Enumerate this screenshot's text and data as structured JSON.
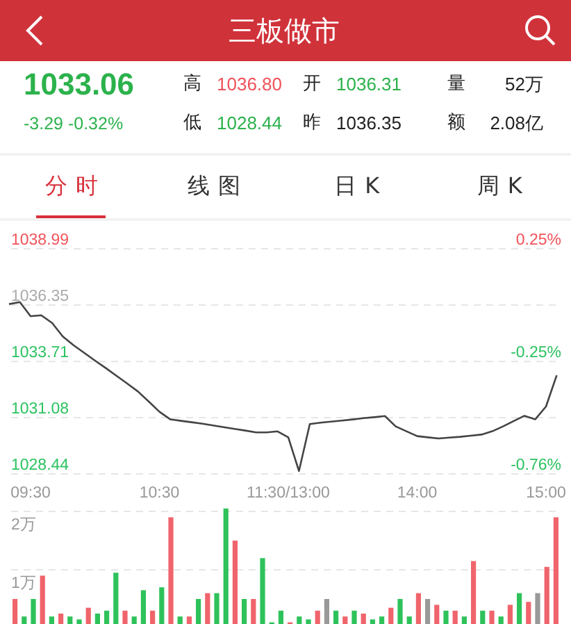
{
  "header": {
    "title": "三板做市"
  },
  "quote": {
    "price": "1033.06",
    "change": "-3.29 -0.32%",
    "color": "#2cb24c",
    "stats": [
      {
        "label": "高",
        "value": "1036.80",
        "color": "#f0525a"
      },
      {
        "label": "开",
        "value": "1036.31",
        "color": "#2cb24c"
      },
      {
        "label": "量",
        "value": "52万",
        "color": "#222222"
      },
      {
        "label": "低",
        "value": "1028.44",
        "color": "#2cb24c"
      },
      {
        "label": "昨",
        "value": "1036.35",
        "color": "#222222"
      },
      {
        "label": "额",
        "value": "2.08亿",
        "color": "#222222"
      }
    ]
  },
  "tabs": [
    {
      "label": "分时",
      "selected": true
    },
    {
      "label": "线图",
      "selected": false
    },
    {
      "label": "日K",
      "selected": false
    },
    {
      "label": "周K",
      "selected": false
    }
  ],
  "price_chart": {
    "left_axis": [
      {
        "color": "#f0525a"
      },
      {
        "color": "#aaaaaa"
      },
      {
        "color": "#2cc260"
      },
      {
        "color": "#2cc260"
      },
      {
        "color": "#2cc260"
      }
    ],
    "right_axis": [
      {
        "label": "0.25%",
        "color": "#f0525a"
      },
      {
        "label": "-0.25%",
        "color": "#2cc260"
      },
      {
        "label": "-0.76%",
        "color": "#2cc260"
      }
    ],
    "chart_data": {
      "type": "line",
      "grid": true,
      "ylim": [
        1028.44,
        1038.99
      ],
      "yticks": [
        {
          "value": 1038.99,
          "label": "1038.99"
        },
        {
          "value": 1036.35,
          "label": "1036.35"
        },
        {
          "value": 1033.71,
          "label": "1033.71"
        },
        {
          "value": 1031.08,
          "label": "1031.08"
        },
        {
          "value": 1028.44,
          "label": "1028.44"
        }
      ],
      "categories": [
        null,
        null,
        "09:30",
        null,
        null,
        null,
        null,
        null,
        null,
        null,
        null,
        null,
        null,
        null,
        "10:30",
        null,
        null,
        null,
        null,
        null,
        null,
        null,
        null,
        null,
        null,
        null,
        "11:30/13:00",
        null,
        null,
        null,
        null,
        null,
        null,
        null,
        null,
        null,
        null,
        null,
        "14:00",
        null,
        null,
        null,
        null,
        null,
        null,
        null,
        null,
        null,
        null,
        null,
        "15:00",
        null
      ],
      "series": [
        {
          "color": "#444444",
          "values": [
            1036.4,
            1036.49,
            1035.83,
            1035.87,
            1035.51,
            1034.88,
            1034.47,
            1034.11,
            1033.75,
            1033.4,
            1033.04,
            1032.67,
            1032.3,
            1031.83,
            1031.35,
            1031.0,
            1030.93,
            1030.86,
            1030.79,
            1030.71,
            1030.63,
            1030.55,
            1030.47,
            1030.39,
            1030.39,
            1030.43,
            1030.15,
            1028.58,
            1030.78,
            1030.84,
            1030.89,
            1030.94,
            1030.99,
            1031.05,
            1031.1,
            1031.15,
            1030.67,
            1030.44,
            1030.21,
            1030.15,
            1030.1,
            1030.14,
            1030.18,
            1030.23,
            1030.28,
            1030.44,
            1030.67,
            1030.92,
            1031.16,
            1031.0,
            1031.6,
            1033.06
          ]
        }
      ]
    }
  },
  "volume_chart": {
    "chart_data": {
      "type": "bar",
      "stacked": true,
      "ylim": [
        0,
        2.1
      ],
      "yticks": [
        {
          "value": 1,
          "label": "1万"
        },
        {
          "value": 2,
          "label": "2万"
        }
      ],
      "series": [
        {
          "color": "#f0646c",
          "values": [
            0.5,
            null,
            null,
            0.9,
            null,
            0.25,
            null,
            null,
            0.35,
            null,
            null,
            null,
            0.3,
            null,
            null,
            0.3,
            null,
            1.9,
            null,
            0.2,
            null,
            0.6,
            null,
            null,
            1.5,
            null,
            0.5,
            null,
            null,
            null,
            0.1,
            null,
            null,
            0.3,
            null,
            null,
            0.2,
            null,
            0.25,
            null,
            null,
            0.35,
            null,
            null,
            0.6,
            null,
            0.4,
            null,
            0.3,
            null,
            1.15,
            null,
            0.3,
            null,
            0.4,
            null,
            0.45,
            null,
            1.05,
            1.9
          ]
        },
        {
          "color": "#2ec25a",
          "values": [
            null,
            0.2,
            0.5,
            null,
            0.2,
            null,
            0.2,
            0.15,
            null,
            0.25,
            0.3,
            0.95,
            null,
            0.2,
            0.65,
            null,
            0.7,
            null,
            0.2,
            null,
            0.5,
            null,
            0.6,
            2.05,
            null,
            0.5,
            null,
            1.2,
            0.1,
            0.3,
            null,
            0.2,
            0.15,
            null,
            null,
            0.3,
            null,
            0.3,
            null,
            0.15,
            0.2,
            null,
            0.5,
            0.2,
            null,
            null,
            null,
            0.3,
            null,
            0.2,
            null,
            0.3,
            null,
            0.2,
            null,
            0.6,
            null,
            null,
            null,
            null
          ]
        },
        {
          "color": "#999999",
          "values": [
            null,
            null,
            null,
            null,
            null,
            null,
            null,
            null,
            null,
            null,
            null,
            null,
            null,
            null,
            null,
            null,
            null,
            null,
            null,
            null,
            null,
            null,
            null,
            null,
            null,
            null,
            null,
            null,
            null,
            null,
            null,
            null,
            null,
            null,
            0.5,
            null,
            null,
            null,
            null,
            null,
            null,
            null,
            null,
            null,
            null,
            0.5,
            null,
            null,
            null,
            null,
            null,
            null,
            null,
            null,
            null,
            null,
            null,
            0.6,
            null,
            null
          ]
        }
      ]
    }
  }
}
